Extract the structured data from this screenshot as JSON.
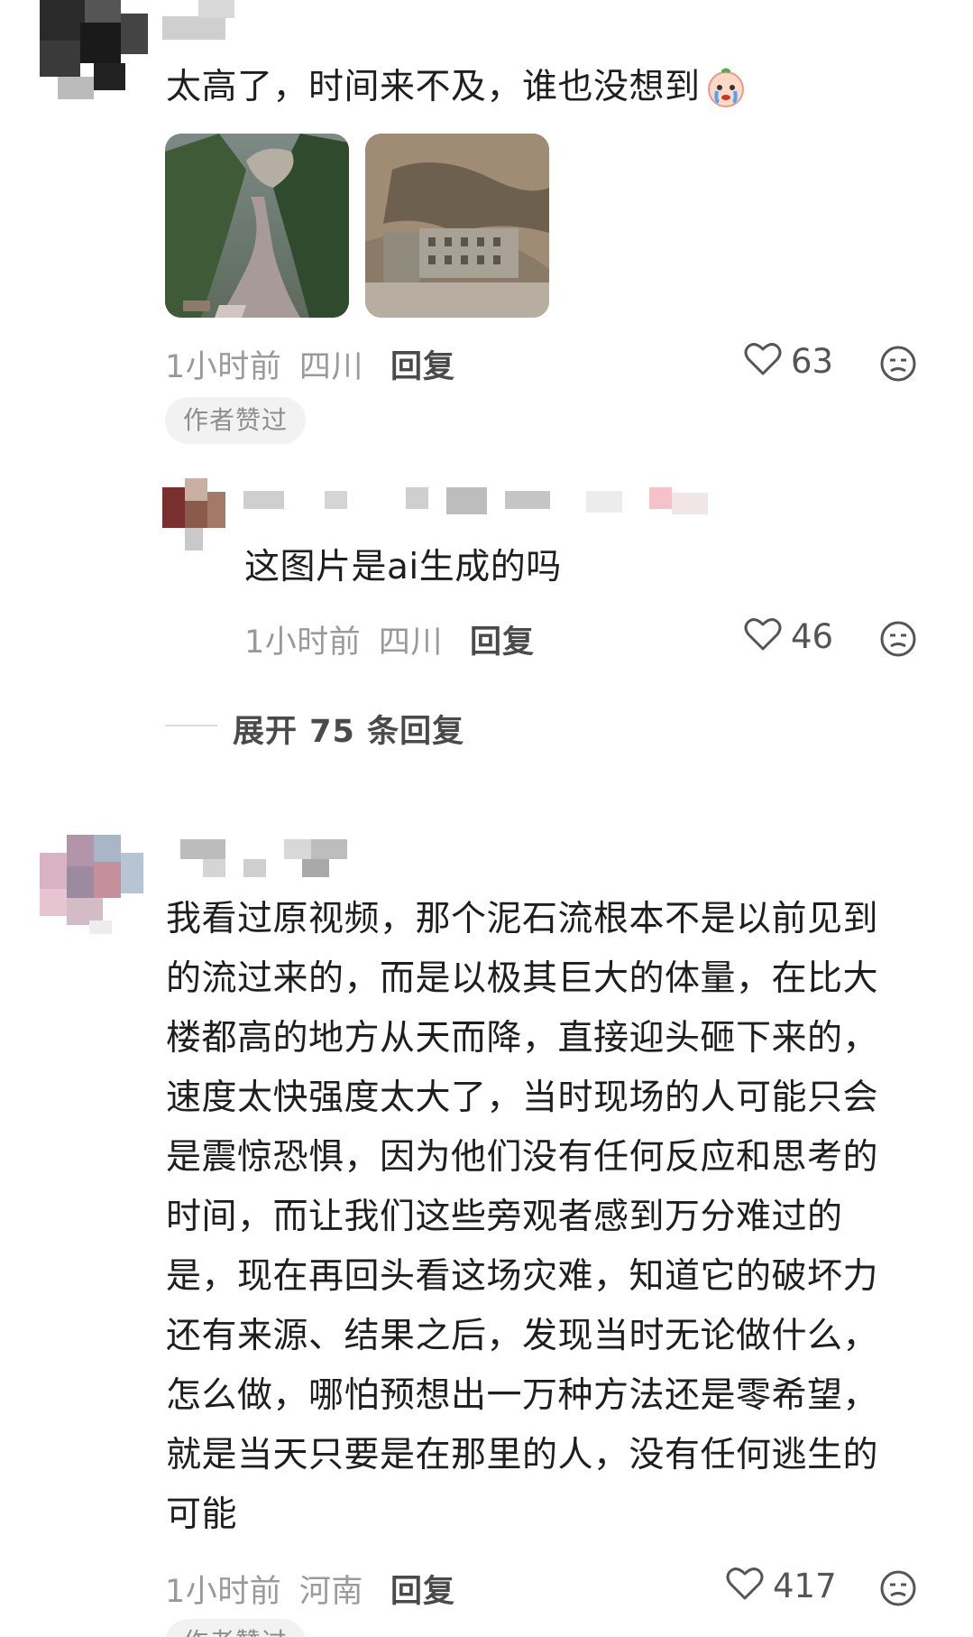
{
  "comments": [
    {
      "text": "太高了，时间来不及，谁也没想到",
      "emoji": "crying-face-emoji",
      "images": [
        "mudslide-valley-photo",
        "mudslide-building-photo"
      ],
      "time": "1小时前",
      "location": "四川",
      "reply_label": "回复",
      "likes": "63",
      "badge": "作者赞过",
      "replies": [
        {
          "text": "这图片是ai生成的吗",
          "time": "1小时前",
          "location": "四川",
          "reply_label": "回复",
          "likes": "46"
        }
      ],
      "expand_label": "展开 75 条回复"
    },
    {
      "lines": [
        "我看过原视频，那个泥石流根本不是以前见到",
        "的流过来的，而是以极其巨大的体量，在比大",
        "楼都高的地方从天而降，直接迎头砸下来的，",
        "速度太快强度太大了，当时现场的人可能只会",
        "是震惊恐惧，因为他们没有任何反应和思考的",
        "时间，而让我们这些旁观者感到万分难过的",
        "是，现在再回头看这场灾难，知道它的破坏力",
        "还有来源、结果之后，发现当时无论做什么，",
        "怎么做，哪怕预想出一万种方法还是零希望，",
        "就是当天只要是在那里的人，没有任何逃生的",
        "可能"
      ],
      "time": "1小时前",
      "location": "河南",
      "reply_label": "回复",
      "likes": "417",
      "badge": "作者赞过"
    }
  ],
  "colors": {
    "text": "#1e1e1e",
    "meta": "#9a9a9a",
    "badge_bg": "#f2f2f2"
  }
}
